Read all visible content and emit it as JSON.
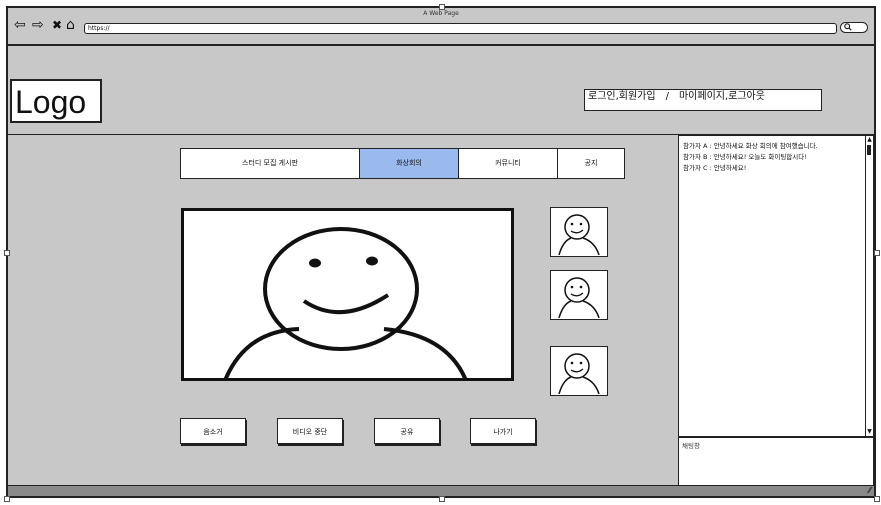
{
  "window": {
    "title": "A Web Page"
  },
  "nav": {
    "back": "⇦",
    "forward": "⇨",
    "close": "✖",
    "home": "⌂"
  },
  "address_bar": {
    "url": "https://"
  },
  "search": {
    "icon": "🔍"
  },
  "header": {
    "logo_text": "Logo",
    "auth_left": "로그인,회원가입",
    "auth_separator": "/",
    "auth_right": "마이페이지,로그아웃"
  },
  "tabs": [
    {
      "label": "스터디 모집 게시판",
      "active": false
    },
    {
      "label": "화상회의",
      "active": true
    },
    {
      "label": "커뮤니티",
      "active": false
    },
    {
      "label": "공지",
      "active": false
    }
  ],
  "controls": {
    "mute": "음소거",
    "video_stop": "비디오 중단",
    "share": "공유",
    "leave": "나가기"
  },
  "chat": {
    "messages": [
      "참가자 A : 안녕하세요 화상 회의에 참여했습니다.",
      "참가자 B : 안녕하세요! 오늘도 화이팅합시다!",
      "참가자 C : 안녕하세요!"
    ],
    "input_placeholder": "채팅창"
  },
  "colors": {
    "active_tab": "#9ab9ec",
    "frame_bg": "#c8c8c8"
  },
  "icons": {
    "participant_avatar": "smiley-face-sketch"
  }
}
